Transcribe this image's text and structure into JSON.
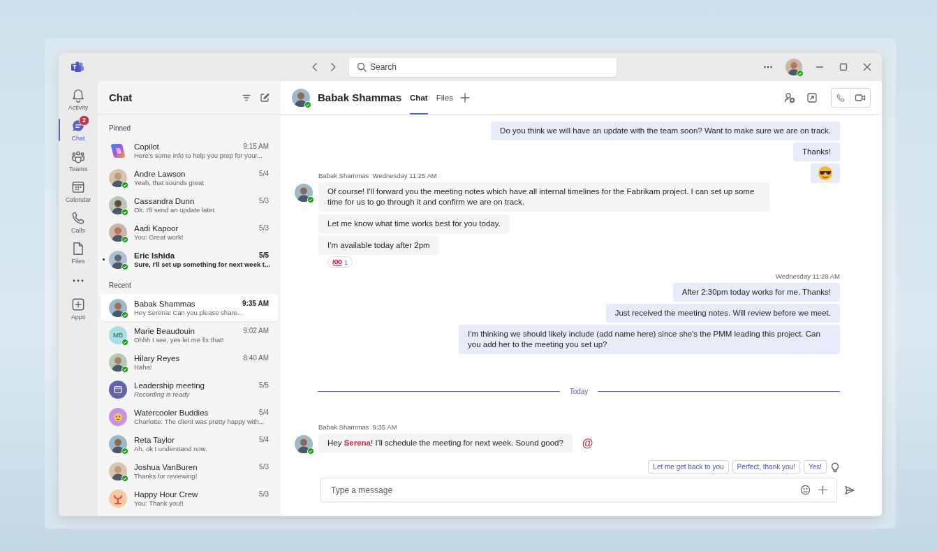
{
  "title_bar": {
    "search": {
      "placeholder": "Search"
    }
  },
  "rail": {
    "items": [
      {
        "kind": "app",
        "label": "Activity",
        "selected": false
      },
      {
        "kind": "app",
        "label": "Chat",
        "selected": true,
        "badge": "2"
      },
      {
        "kind": "app",
        "label": "Teams",
        "selected": false
      },
      {
        "kind": "app",
        "label": "Calendar",
        "selected": false
      },
      {
        "kind": "app",
        "label": "Calls",
        "selected": false
      },
      {
        "kind": "app",
        "label": "Files",
        "selected": false
      },
      {
        "kind": "more"
      },
      {
        "kind": "app",
        "label": "Apps",
        "selected": false
      }
    ]
  },
  "chat_list": {
    "title": "Chat",
    "sections": [
      {
        "heading": "Pinned",
        "chats": [
          {
            "kind": "copilot",
            "name": "Copilot",
            "preview": "Here's some info to help you prep for your...",
            "time": "9:15 AM",
            "online": false,
            "unread": false,
            "selected": false
          },
          {
            "kind": "photo",
            "name": "Andre Lawson",
            "preview": "Yeah, that sounds great",
            "time": "5/4",
            "online": true,
            "unread": false,
            "selected": false
          },
          {
            "kind": "photo",
            "name": "Cassandra Dunn",
            "preview": "Ok. I'll send an update later.",
            "time": "5/3",
            "online": true,
            "unread": false,
            "selected": false
          },
          {
            "kind": "photo",
            "name": "Aadi Kapoor",
            "preview": "You: Great work!",
            "time": "5/3",
            "online": true,
            "unread": false,
            "selected": false
          },
          {
            "kind": "photo",
            "name": "Eric Ishida",
            "preview": "Sure, I'll set up something for next week t...",
            "time": "5/5",
            "online": true,
            "unread": true,
            "selected": false
          }
        ]
      },
      {
        "heading": "Recent",
        "chats": [
          {
            "kind": "photo",
            "name": "Babak Shammas",
            "preview": "Hey Serena! Can you please share...",
            "time": "9:35 AM",
            "online": true,
            "unread": false,
            "selected": true
          },
          {
            "kind": "initials",
            "initials": "MB",
            "name": "Marie Beaudouin",
            "preview": "Ohhh I see, yes let me fix that!",
            "time": "9:02 AM",
            "online": true,
            "unread": false,
            "selected": false
          },
          {
            "kind": "photo",
            "name": "Hilary Reyes",
            "preview": "Haha!",
            "time": "8:40 AM",
            "online": true,
            "unread": false,
            "selected": false
          },
          {
            "kind": "meeting",
            "name": "Leadership meeting",
            "preview": "Recording is ready",
            "preview_italic": true,
            "time": "5/5",
            "online": false,
            "unread": false,
            "selected": false
          },
          {
            "kind": "group",
            "name": "Watercooler Buddies",
            "preview": "Charlotte: The client was pretty happy with...",
            "time": "5/4",
            "online": false,
            "unread": false,
            "selected": false
          },
          {
            "kind": "photo",
            "name": "Reta Taylor",
            "preview": "Ah, ok I understand now.",
            "time": "5/4",
            "online": true,
            "unread": false,
            "selected": false
          },
          {
            "kind": "photo",
            "name": "Joshua VanBuren",
            "preview": "Thanks for reviewing!",
            "time": "5/3",
            "online": true,
            "unread": false,
            "selected": false
          },
          {
            "kind": "group2",
            "name": "Happy Hour Crew",
            "preview": "You: Thank you!!",
            "time": "5/3",
            "online": false,
            "unread": false,
            "selected": false
          }
        ]
      }
    ]
  },
  "conversation": {
    "header": {
      "name": "Babak Shammas",
      "online": true,
      "tabs": [
        {
          "label": "Chat",
          "selected": true
        },
        {
          "label": "Files",
          "selected": false
        }
      ]
    },
    "items": [
      {
        "kind": "outgoing",
        "messages": [
          "Do you think we will have an update with the team soon? Want to make sure we are on track.",
          "Thanks!"
        ],
        "sticker": true
      },
      {
        "kind": "incoming",
        "sender": "Babak Shammas",
        "time": "Wednesday 11:25 AM",
        "online": true,
        "messages": [
          "Of course! I'll forward you the meeting notes which have all internal timelines for the Fabrikam project. I can set up some time for us to go through it and confirm we are on track.",
          "Let me know what time works best for you today.",
          "I'm available today after 2pm"
        ],
        "reaction_count": "1"
      },
      {
        "kind": "outgoing",
        "time": "Wednesday 11:28 AM",
        "messages": [
          "After 2:30pm today works for me. Thanks!",
          "Just received the meeting notes. Will review before we meet.",
          "I'm thinking we should likely include (add name here) since she's the PMM leading this project. Can you add her to the meeting you set up?"
        ]
      },
      {
        "kind": "divider",
        "label": "Today"
      },
      {
        "kind": "incoming",
        "sender": "Babak Shammas",
        "time": "9:35 AM",
        "online": true,
        "messages": [
          "Hey **Serena**! I'll schedule the meeting for next week. Sound good?"
        ],
        "mention": "@"
      }
    ],
    "suggestions": [
      "Let me get back to you",
      "Perfect, thank you!",
      "Yes!"
    ],
    "composer": {
      "placeholder": "Type a message"
    }
  }
}
